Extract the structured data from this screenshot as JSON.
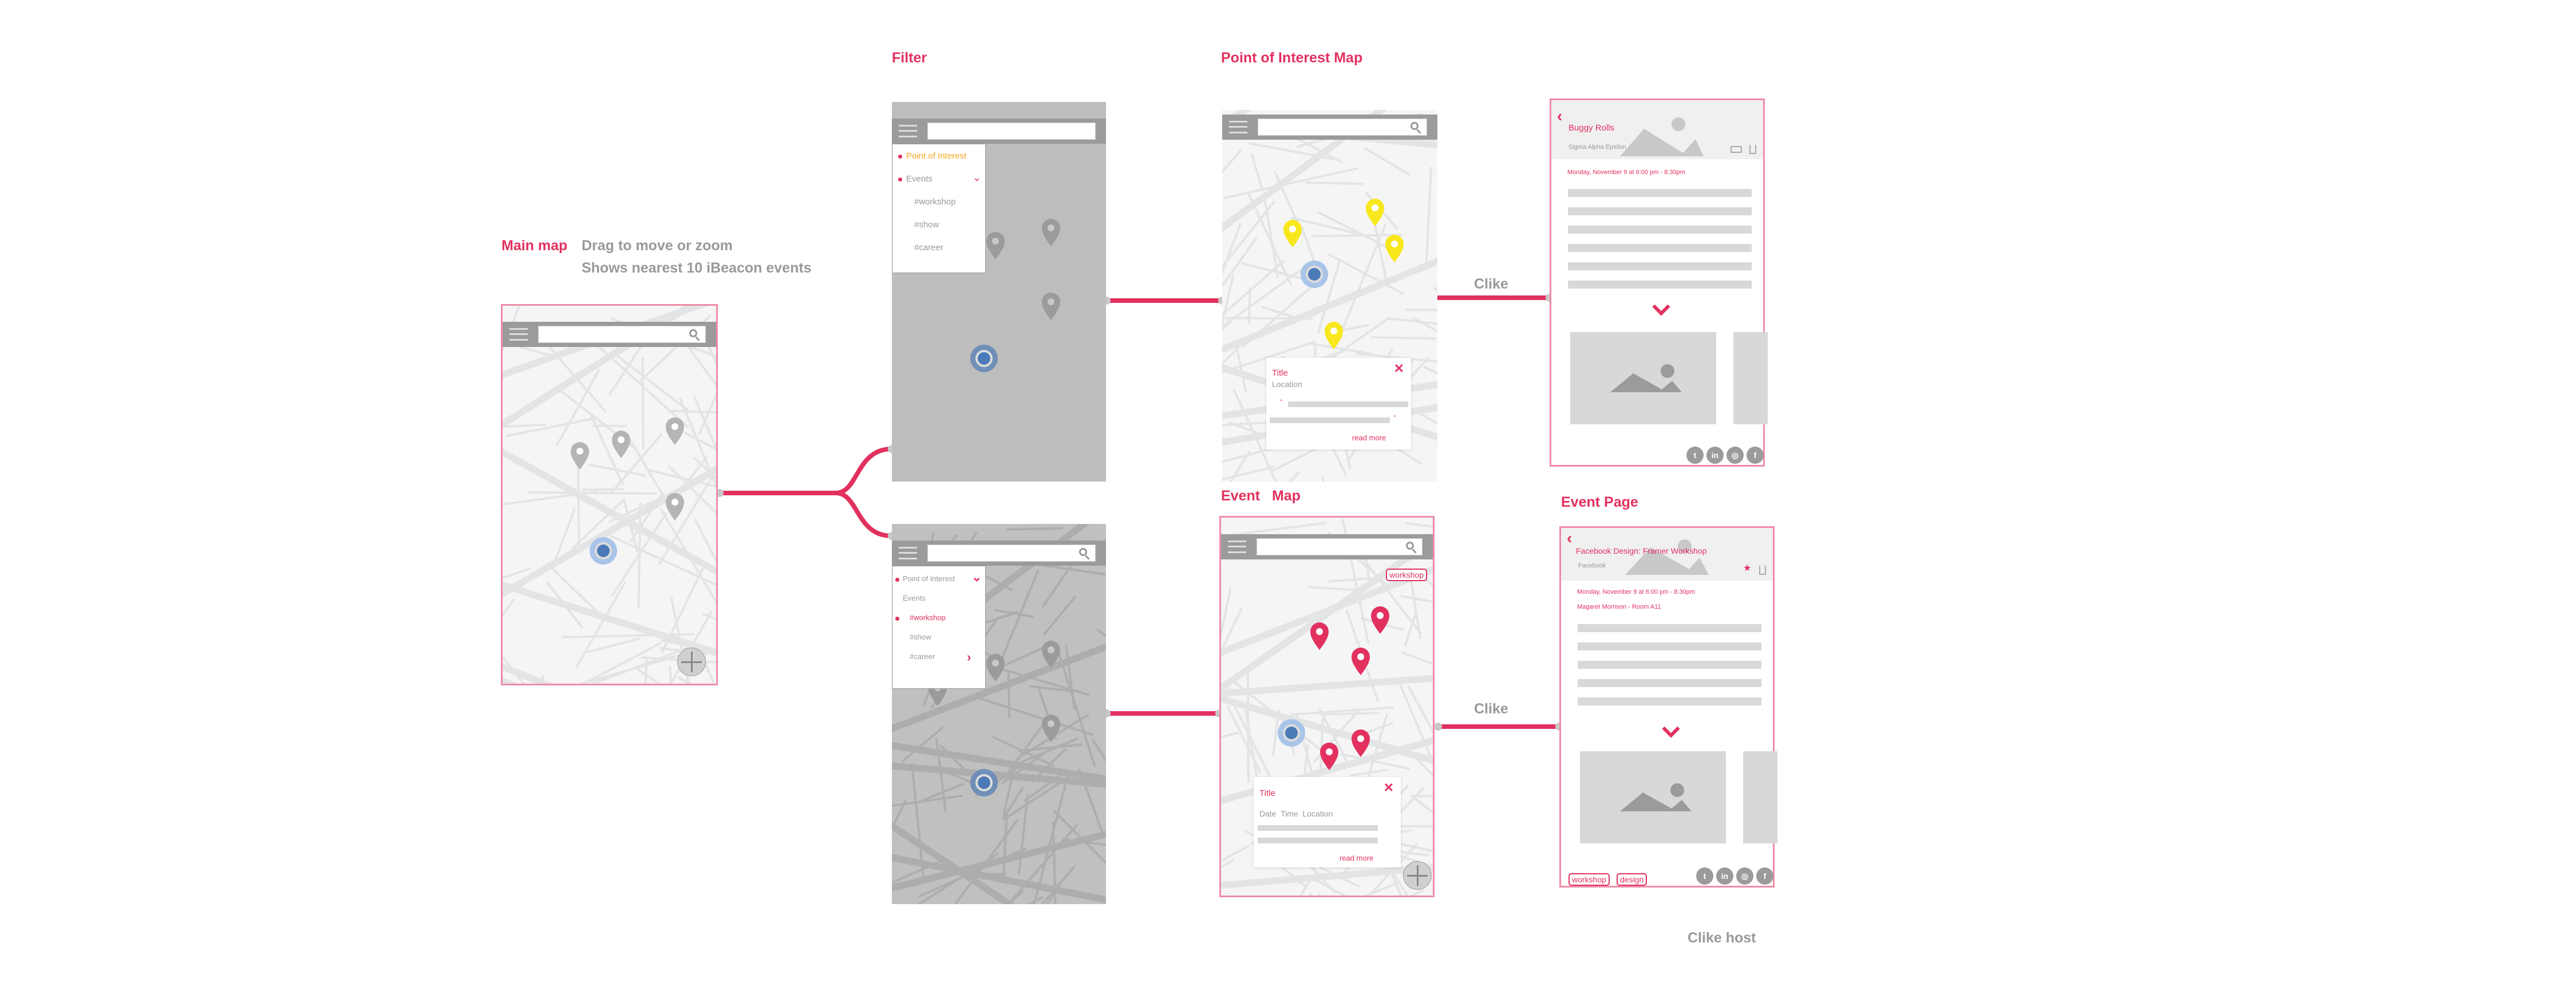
{
  "colors": {
    "accent": "#e2315f",
    "poi_orange": "#f5a623",
    "pin_gray": "#9b9b9b",
    "pin_yellow": "#f8e71c",
    "location_blue": "#4a7ab8",
    "connector": "#e2315f"
  },
  "labels": {
    "main_map": "Main map",
    "filter": "Filter",
    "poi_map": "Point of Interest Map",
    "event_map_1": "Event",
    "event_map_2": "Map",
    "event_page": "Event Page"
  },
  "notes": {
    "drag": "Drag to move or zoom",
    "nearest": "Shows nearest 10 iBeacon events",
    "click1": "Clike",
    "click2": "Clike",
    "click_host": "Clike host"
  },
  "filter1": {
    "items": [
      {
        "label": "Point of Interest"
      },
      {
        "label": "Events"
      },
      {
        "label": "#workshop"
      },
      {
        "label": "#show"
      },
      {
        "label": "#career"
      }
    ]
  },
  "filter2": {
    "items": [
      {
        "label": "Point of Interest"
      },
      {
        "label": "Events"
      },
      {
        "label": "#workshop"
      },
      {
        "label": "#show"
      },
      {
        "label": "#career"
      }
    ]
  },
  "poi_popup": {
    "title": "Title",
    "subtitle": "Location",
    "open_quote": "“",
    "close_quote": "”",
    "read_more": "read more",
    "close": "✕"
  },
  "event_map": {
    "filter_tag": "workshop"
  },
  "event_popup": {
    "title": "Title",
    "subtitle": "Date  Time  Location",
    "read_more": "read more",
    "close": "✕"
  },
  "poi_detail": {
    "back": "‹",
    "title": "Buggy Rolls",
    "host": "Sigma Alpha Epsilon",
    "datetime": "Monday, November 9 at 6:00 pm - 8:30pm",
    "icons": [
      "vr-icon",
      "share-icon"
    ]
  },
  "event_detail": {
    "back": "‹",
    "title": "Facebook Design: Framer Workshop",
    "host": "Facebook",
    "datetime": "Monday, November 9 at 6:00 pm - 8:30pm",
    "location": "Magaret Morrison - Room A11",
    "tags": [
      "workshop",
      "design"
    ],
    "icons": [
      "star-icon",
      "share-icon"
    ]
  },
  "social": [
    {
      "name": "twitter-icon",
      "glyph": "t"
    },
    {
      "name": "linkedin-icon",
      "glyph": "in"
    },
    {
      "name": "instagram-icon",
      "glyph": "◎"
    },
    {
      "name": "facebook-icon",
      "glyph": "f"
    }
  ]
}
